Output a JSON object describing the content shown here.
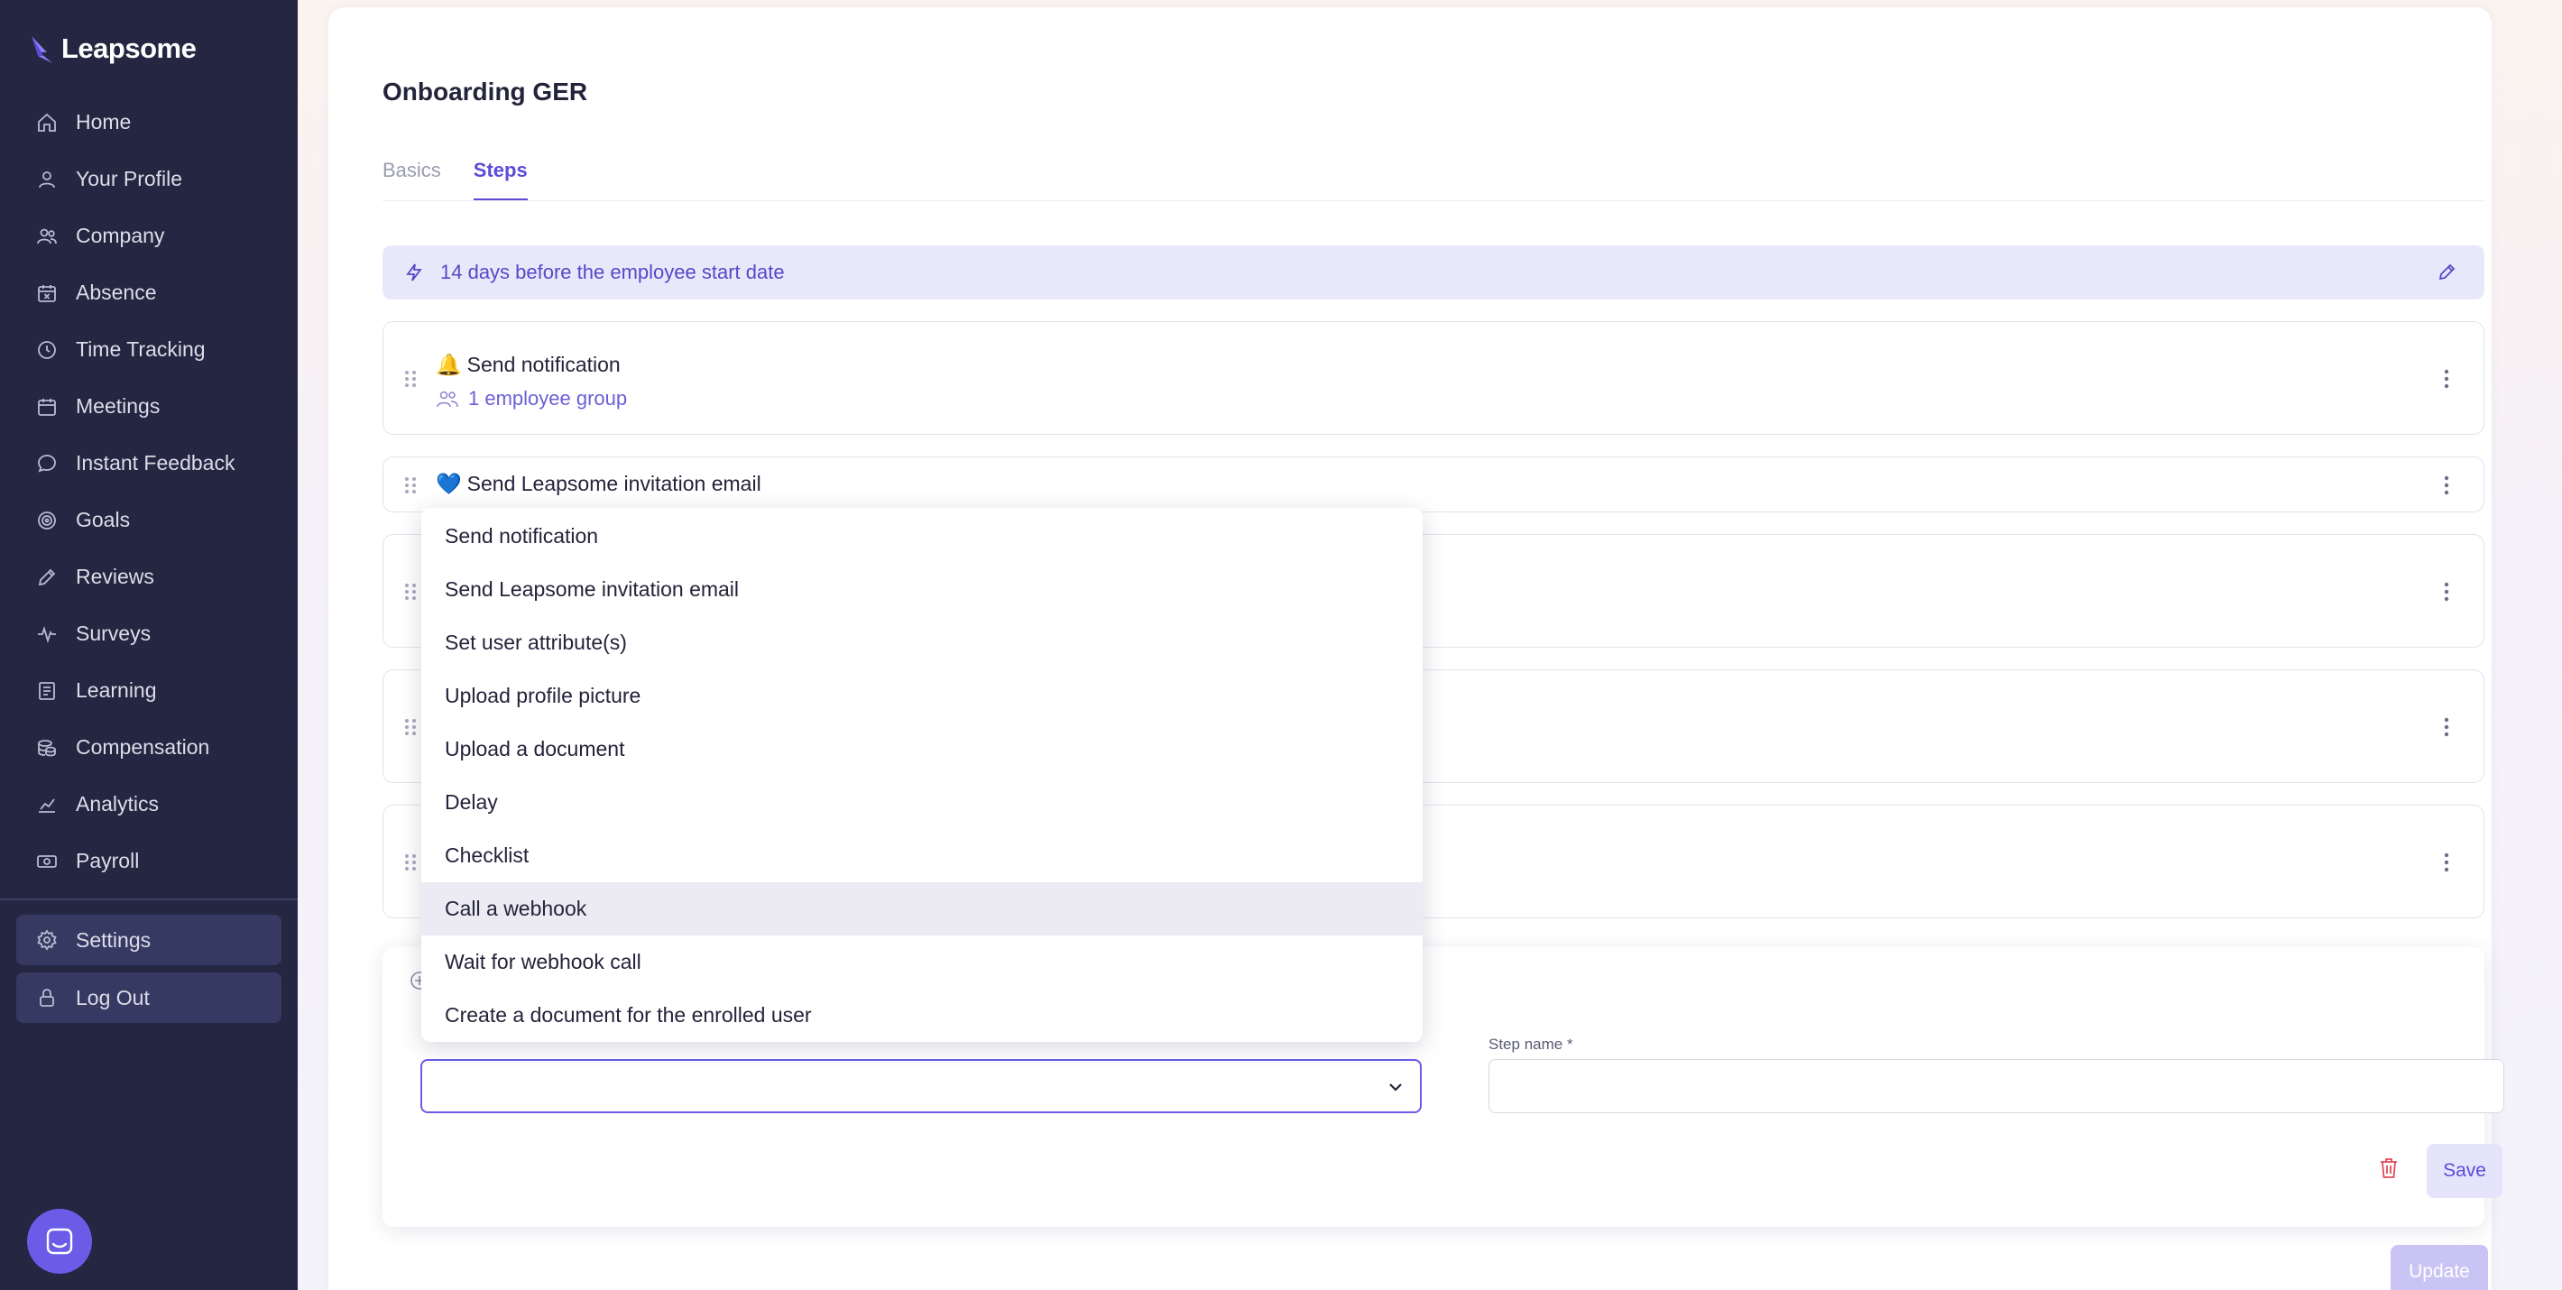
{
  "app": {
    "name": "Leapsome"
  },
  "sidebar": {
    "items": [
      {
        "label": "Home",
        "icon": "home-icon"
      },
      {
        "label": "Your Profile",
        "icon": "user-icon"
      },
      {
        "label": "Company",
        "icon": "users-icon"
      },
      {
        "label": "Absence",
        "icon": "calendar-x-icon"
      },
      {
        "label": "Time Tracking",
        "icon": "clock-icon"
      },
      {
        "label": "Meetings",
        "icon": "calendar-icon"
      },
      {
        "label": "Instant Feedback",
        "icon": "chat-icon"
      },
      {
        "label": "Goals",
        "icon": "target-icon"
      },
      {
        "label": "Reviews",
        "icon": "pencil-icon"
      },
      {
        "label": "Surveys",
        "icon": "pulse-icon"
      },
      {
        "label": "Learning",
        "icon": "book-icon"
      },
      {
        "label": "Compensation",
        "icon": "coins-icon"
      },
      {
        "label": "Analytics",
        "icon": "chart-icon"
      },
      {
        "label": "Payroll",
        "icon": "money-icon"
      }
    ],
    "settings_label": "Settings",
    "logout_label": "Log Out"
  },
  "page": {
    "title": "Onboarding GER",
    "tabs": [
      "Basics",
      "Steps"
    ],
    "active_tab": "Steps",
    "trigger_text": "14 days before the employee start date",
    "steps": [
      {
        "emoji": "🔔",
        "title": "Send notification",
        "subtitle": "1 employee group"
      },
      {
        "emoji": "💙",
        "title": "Send Leapsome invitation email"
      }
    ],
    "form": {
      "step_name_label": "Step name *",
      "step_name_value": "",
      "save_label": "Save"
    },
    "update_label": "Update"
  },
  "dropdown": {
    "options": [
      "Send notification",
      "Send Leapsome invitation email",
      "Set user attribute(s)",
      "Upload profile picture",
      "Upload a document",
      "Delay",
      "Checklist",
      "Call a webhook",
      "Wait for webhook call",
      "Create a document for the enrolled user"
    ],
    "highlighted": "Call a webhook"
  },
  "colors": {
    "sidebar_bg": "#242642",
    "accent": "#5b4bd7",
    "trigger_bg": "#e9e8fb",
    "danger": "#e04a5a"
  }
}
